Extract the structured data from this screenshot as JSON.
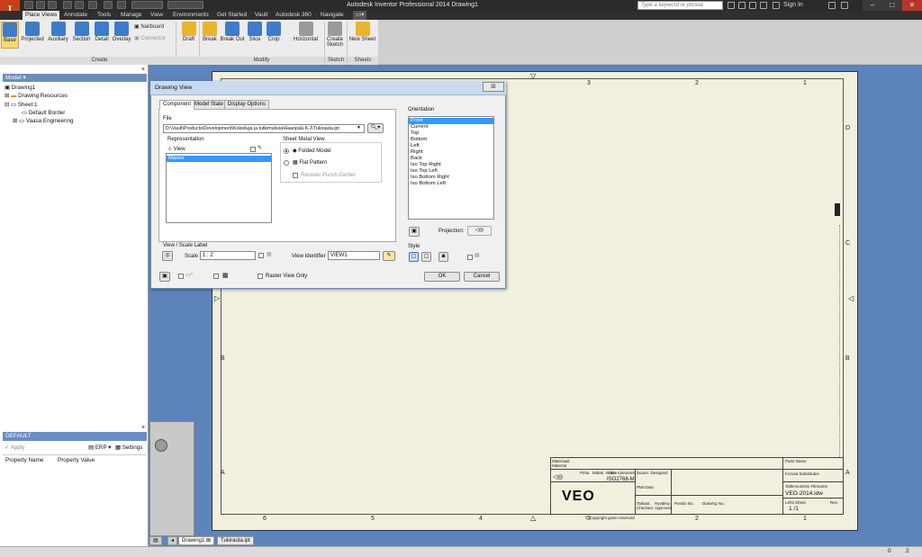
{
  "app": {
    "logo": "I",
    "window_title": "Autodesk Inventor Professional 2014    Drawing1",
    "search_placeholder": "Type a keyword or phrase",
    "sign_in": "Sign In"
  },
  "ribbon": {
    "tabs": [
      "Place Views",
      "Annotate",
      "Tools",
      "Manage",
      "View",
      "Environments",
      "Get Started",
      "Vault",
      "Autodesk 360",
      "Navigate"
    ],
    "active_tab": "Place Views",
    "create_buttons": [
      "Base",
      "Projected",
      "Auxiliary",
      "Section",
      "Detail",
      "Overlay"
    ],
    "small_buttons": [
      "Nailboard",
      "Connector"
    ],
    "modify_buttons": [
      "Draft",
      "Break",
      "Break Out",
      "Slice",
      "Crop",
      "Horizontal"
    ],
    "sketch_button": "Create Sketch",
    "sheet_button": "New Sheet",
    "groups": {
      "create": "Create",
      "modify": "Modify",
      "sketch": "Sketch",
      "sheets": "Sheets"
    }
  },
  "browser": {
    "header": "Model ▾",
    "items": [
      "Drawing1",
      "Drawing Resources",
      "Sheet:1",
      "Default Border",
      "Vaasa Engineering"
    ]
  },
  "properties": {
    "header": "DEFAULT",
    "apply": "Apply",
    "erp": "ERP",
    "settings": "Settings",
    "columns": [
      "Property Name",
      "Property Value"
    ]
  },
  "drawing": {
    "top_zones": [
      "3",
      "2",
      "1"
    ],
    "bottom_zones": [
      "6",
      "5",
      "4",
      "3",
      "2",
      "1"
    ],
    "right_zones": [
      "D",
      "C",
      "B",
      "A"
    ],
    "left_zones": [
      "B",
      "A"
    ],
    "logo": "VEO",
    "tb_text": {
      "material": "Materiaali",
      "material2": "Material",
      "surface": "Pinta",
      "scale": "Mittak. Scale",
      "tolerance": "Yleis-toleranssi",
      "iso": "ISO2768-M",
      "pmi": "PMI Data",
      "designed": "Suunn. Designed",
      "checked": "Tarkast. Checked",
      "approved": "Hyväksy. Approved",
      "position": "Positio No.",
      "drawing_no": "Drawing No.",
      "parts_name": "Parts Name",
      "drawing_name": "Korvaa Substitutes",
      "filename_lbl": "Tallennusnimi Filename",
      "filename": "VEO-2014.idw",
      "sheet_lbl": "Lehti Sheet",
      "sheet": "1 /1",
      "revision": "Rev.",
      "copyright": "© Copyright given reserved"
    }
  },
  "dialog": {
    "title": "Drawing View",
    "close": "☒",
    "tabs": [
      "Component",
      "Model State",
      "Display Options"
    ],
    "file_label": "File",
    "file_path": "D:\\Vault\\Products\\Development\\Kokeiluja ja tutkimuksia\\Haanpää.K-J\\Tukirauta.ipt",
    "representation_label": "Representation",
    "view_label": "View",
    "rep_item": "Master",
    "sheet_metal_label": "Sheet Metal View",
    "folded": "Folded Model",
    "flat": "Flat Pattern",
    "recover": "Recover Punch Center",
    "orientation_label": "Orientation",
    "orientations": [
      "Front",
      "Current",
      "Top",
      "Bottom",
      "Left",
      "Right",
      "Back",
      "Iso Top Right",
      "Iso Top Left",
      "Iso Bottom Right",
      "Iso Bottom Left"
    ],
    "projection_label": "Projection:",
    "style_label": "Style",
    "scale_section": "View / Scale Label",
    "scale_label": "Scale",
    "scale_value": "1 : 2",
    "view_identifier_label": "View Identifier",
    "view_identifier": "VIEW1",
    "raster": "Raster View Only",
    "ok": "OK",
    "cancel": "Cancel"
  },
  "doc_tabs": [
    "Drawing1",
    "Tukirauta.ipt"
  ],
  "status": {
    "left": "0",
    "right": "2"
  }
}
